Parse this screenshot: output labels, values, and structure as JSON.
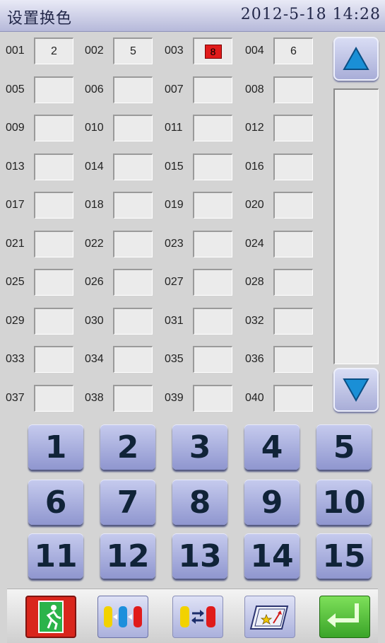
{
  "header": {
    "title": "设置换色",
    "datetime": "2012-5-18 14:28"
  },
  "slots": [
    {
      "label": "001",
      "value": "2"
    },
    {
      "label": "002",
      "value": "5"
    },
    {
      "label": "003",
      "value": "8",
      "highlight": true
    },
    {
      "label": "004",
      "value": "6"
    },
    {
      "label": "005",
      "value": ""
    },
    {
      "label": "006",
      "value": ""
    },
    {
      "label": "007",
      "value": ""
    },
    {
      "label": "008",
      "value": ""
    },
    {
      "label": "009",
      "value": ""
    },
    {
      "label": "010",
      "value": ""
    },
    {
      "label": "011",
      "value": ""
    },
    {
      "label": "012",
      "value": ""
    },
    {
      "label": "013",
      "value": ""
    },
    {
      "label": "014",
      "value": ""
    },
    {
      "label": "015",
      "value": ""
    },
    {
      "label": "016",
      "value": ""
    },
    {
      "label": "017",
      "value": ""
    },
    {
      "label": "018",
      "value": ""
    },
    {
      "label": "019",
      "value": ""
    },
    {
      "label": "020",
      "value": ""
    },
    {
      "label": "021",
      "value": ""
    },
    {
      "label": "022",
      "value": ""
    },
    {
      "label": "023",
      "value": ""
    },
    {
      "label": "024",
      "value": ""
    },
    {
      "label": "025",
      "value": ""
    },
    {
      "label": "026",
      "value": ""
    },
    {
      "label": "027",
      "value": ""
    },
    {
      "label": "028",
      "value": ""
    },
    {
      "label": "029",
      "value": ""
    },
    {
      "label": "030",
      "value": ""
    },
    {
      "label": "031",
      "value": ""
    },
    {
      "label": "032",
      "value": ""
    },
    {
      "label": "033",
      "value": ""
    },
    {
      "label": "034",
      "value": ""
    },
    {
      "label": "035",
      "value": ""
    },
    {
      "label": "036",
      "value": ""
    },
    {
      "label": "037",
      "value": ""
    },
    {
      "label": "038",
      "value": ""
    },
    {
      "label": "039",
      "value": ""
    },
    {
      "label": "040",
      "value": ""
    }
  ],
  "keypad": [
    "1",
    "2",
    "3",
    "4",
    "5",
    "6",
    "7",
    "8",
    "9",
    "10",
    "11",
    "12",
    "13",
    "14",
    "15"
  ],
  "toolbar": {
    "items": [
      {
        "name": "exit-button",
        "icon": "exit-icon"
      },
      {
        "name": "color-change-mode-button",
        "icon": "spools-icon",
        "active": true
      },
      {
        "name": "swap-color-button",
        "icon": "swap-spools-icon"
      },
      {
        "name": "pattern-button",
        "icon": "pattern-icon"
      },
      {
        "name": "confirm-button",
        "icon": "enter-icon"
      }
    ]
  },
  "colors": {
    "highlight": "#e01b1b",
    "title_bar": "#c8cbe6",
    "key_text": "#102338"
  }
}
